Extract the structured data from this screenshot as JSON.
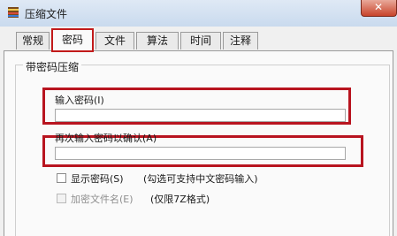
{
  "window": {
    "title": "压缩文件",
    "icon": "archive-icon",
    "close_symbol": "✕"
  },
  "tabs": [
    {
      "label": "常规"
    },
    {
      "label": "密码"
    },
    {
      "label": "文件"
    },
    {
      "label": "算法"
    },
    {
      "label": "时间"
    },
    {
      "label": "注释"
    }
  ],
  "password_group": {
    "title": "带密码压缩",
    "password_label": "输入密码(I)",
    "password_value": "",
    "confirm_label": "再次输入密码以确认(A)",
    "confirm_value": ""
  },
  "options": {
    "show_password_label": "显示密码(S)",
    "show_password_note": "(勾选可支持中文密码输入)",
    "show_password_checked": false,
    "encrypt_names_label": "加密文件名(E)",
    "encrypt_names_note": "(仅限7Z格式)",
    "encrypt_names_checked": false
  },
  "colors": {
    "highlight": "#b8141f",
    "titlebar": "#c9daee"
  }
}
